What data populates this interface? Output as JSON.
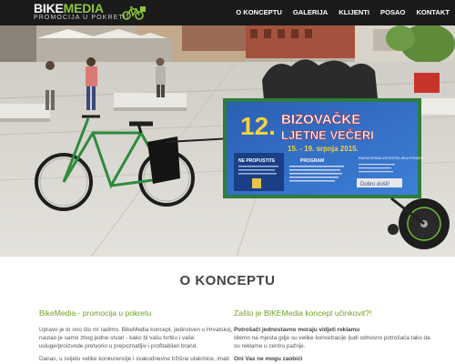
{
  "header": {
    "logo": {
      "part1": "BIKE",
      "part2": "MEDIA",
      "tagline": "PROMOCIJA U POKRETU"
    },
    "nav": [
      {
        "label": "O KONCEPTU"
      },
      {
        "label": "GALERIJA"
      },
      {
        "label": "KLIJENTI"
      },
      {
        "label": "POSAO"
      },
      {
        "label": "KONTAKT"
      }
    ]
  },
  "hero": {
    "banner": {
      "number": "12.",
      "title_line1": "BIZOVAČKE",
      "title_line2": "LJETNE VEČERI",
      "dates": "15. - 19. srpnja 2015.",
      "subheading": "NE PROPUSTITE",
      "program_label": "PROGRAM",
      "sponsor_text": "Dobro došli!",
      "side_text": "RAZNOVRSNA UGOSTITELJSKA PONUDA"
    }
  },
  "main": {
    "section_title": "O KONCEPTU",
    "left": {
      "heading": "BikeMedia - promocija u pokretu",
      "para1": "Upravo je to ono što mi radimo. BikeMedia koncept, jedinstven u Hrvatskoj, nastao je samo zbog jedne stvari - kako bi vašu tvrtku i vaše usluge/proizvode pretvorio u prepoznatljiv i profitabilan brand.",
      "para2": "Danas, u svijetu velike konkurencije i svakodnevne tržišne utakmice, imati samo dobar proizvod, nažalost, nije dovoljno. Bitno je prezentirati ga"
    },
    "right": {
      "heading": "Zašto je BIKEMedia koncept učinkovit?!",
      "para1_bold": "Potrošači jednostavno moraju vidjeti reklamu",
      "para1": "Idemo na mjesta gdje su velike koncetracije ljudi odnosno potrošača tako da su reklame u centru pažnje.",
      "para2_bold": "Oni Vas ne mogu zaobići"
    }
  },
  "colors": {
    "accent_green": "#8dc63f",
    "heading_green": "#6aa121",
    "topbar": "#1b1b1b"
  }
}
